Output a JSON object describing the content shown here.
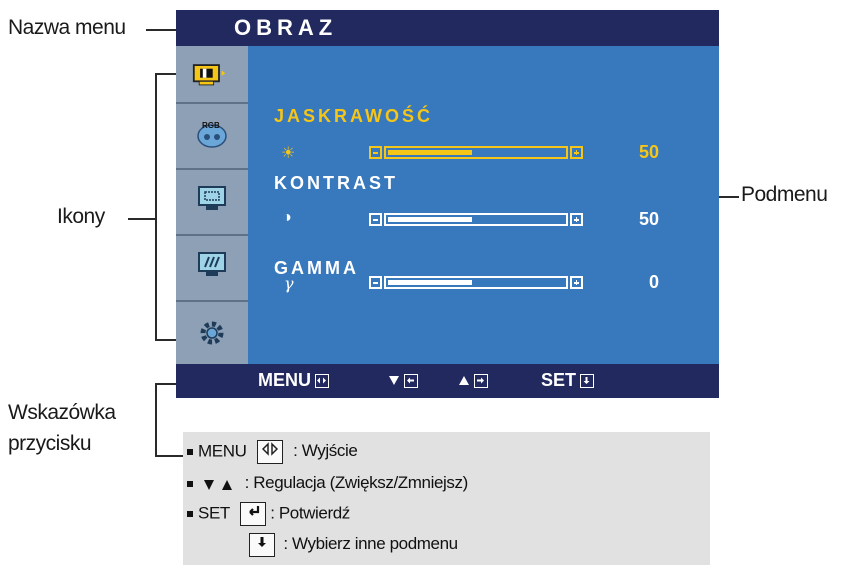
{
  "callouts": {
    "menu_name": "Nazwa menu",
    "icons": "Ikony",
    "submenu": "Podmenu",
    "button_hint_line1": "Wskazówka",
    "button_hint_line2": "przycisku"
  },
  "osd": {
    "title": "OBRAZ",
    "side_icons": [
      "picture-icon",
      "rgb-color-icon",
      "screen-position-icon",
      "tracking-icon",
      "setup-gear-icon"
    ],
    "rgb_icon_text": "RGB",
    "items": [
      {
        "label": "JASKRAWOŚĆ",
        "glyph": "☀",
        "value": "50",
        "level": 0.5,
        "active": true
      },
      {
        "label": "KONTRAST",
        "glyph": "◑",
        "value": "50",
        "level": 0.5,
        "active": false
      },
      {
        "label": "GAMMA",
        "glyph": "γ",
        "value": "0",
        "level": 0.5,
        "active": false
      }
    ],
    "bottom": {
      "menu": "MENU",
      "set": "SET"
    },
    "colors": {
      "title_bar": "#21295e",
      "panel": "#3878bd",
      "sidebar": "#8da0b5",
      "active": "#f5c518"
    }
  },
  "legend": {
    "menu_label": "MENU",
    "menu_desc": ": Wyjście",
    "adjust_desc": ": Regulacja (Zwiększ/Zmniejsz)",
    "set_label": "SET",
    "set_desc": ": Potwierdź",
    "select_desc": ": Wybierz inne podmenu"
  }
}
